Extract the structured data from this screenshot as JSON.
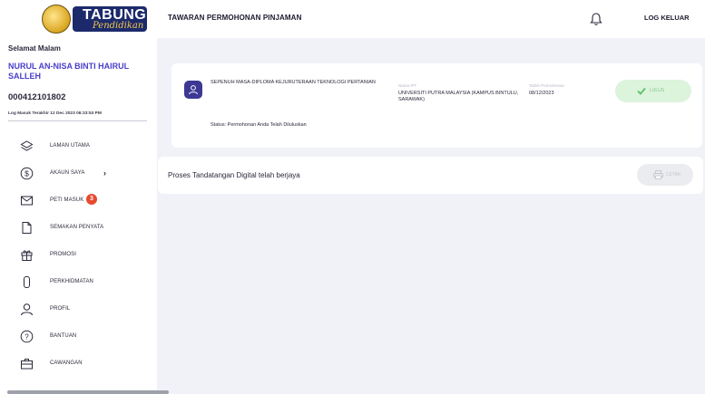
{
  "header": {
    "logo_text": "TABUNG",
    "logo_subtext": "Pendidikan",
    "page_title": "TAWARAN PERMOHONAN PINJAMAN",
    "logout_label": "LOG KELUAR",
    "bell_icon": "bell-icon"
  },
  "sidebar": {
    "greeting": "Selamat Malam",
    "user_name": "NURUL AN-NISA BINTI HAIRUL SALLEH",
    "ic_number": "000412101802",
    "last_login": "Log Masuk Terakhir 12 Dec 2023 06:33:53 PM",
    "items": [
      {
        "label": "LAMAN UTAMA",
        "icon": "layers-icon"
      },
      {
        "label": "AKAUN SAYA",
        "icon": "dollar-icon",
        "chevron": "›"
      },
      {
        "label": "PETI MASUK",
        "icon": "mail-icon",
        "badge": "3"
      },
      {
        "label": "SEMAKAN PENYATA",
        "icon": "document-icon"
      },
      {
        "label": "PROMOSI",
        "icon": "gift-icon"
      },
      {
        "label": "PERKHIDMATAN",
        "icon": "phone-icon"
      },
      {
        "label": "PROFIL",
        "icon": "user-icon"
      },
      {
        "label": "BANTUAN",
        "icon": "help-icon"
      },
      {
        "label": "CAWANGAN",
        "icon": "briefcase-icon"
      }
    ]
  },
  "application": {
    "programme": "SEPENUH MASA-DIPLOMA KEJURUTERAAN TEKNOLOGI PERTANIAN",
    "ipt_label": "Nama IPT",
    "ipt_value": "UNIVERSITI PUTRA MALAYSIA (KAMPUS BINTULU, SARAWAK)",
    "date_label": "Tarikh Permohonan",
    "date_value": "08/12/2023",
    "lulus_label": "LULUS",
    "status": "Status: Permohonan Anda Telah Diluluskan"
  },
  "signature": {
    "message": "Proses Tandatangan Digital telah berjaya",
    "print_label": "CETAK"
  },
  "colors": {
    "accent": "#4a3fc9",
    "avatar": "#3c3893",
    "success_bg": "#dcf3dc",
    "badge": "#e8492e",
    "background": "#f0f2f8"
  }
}
